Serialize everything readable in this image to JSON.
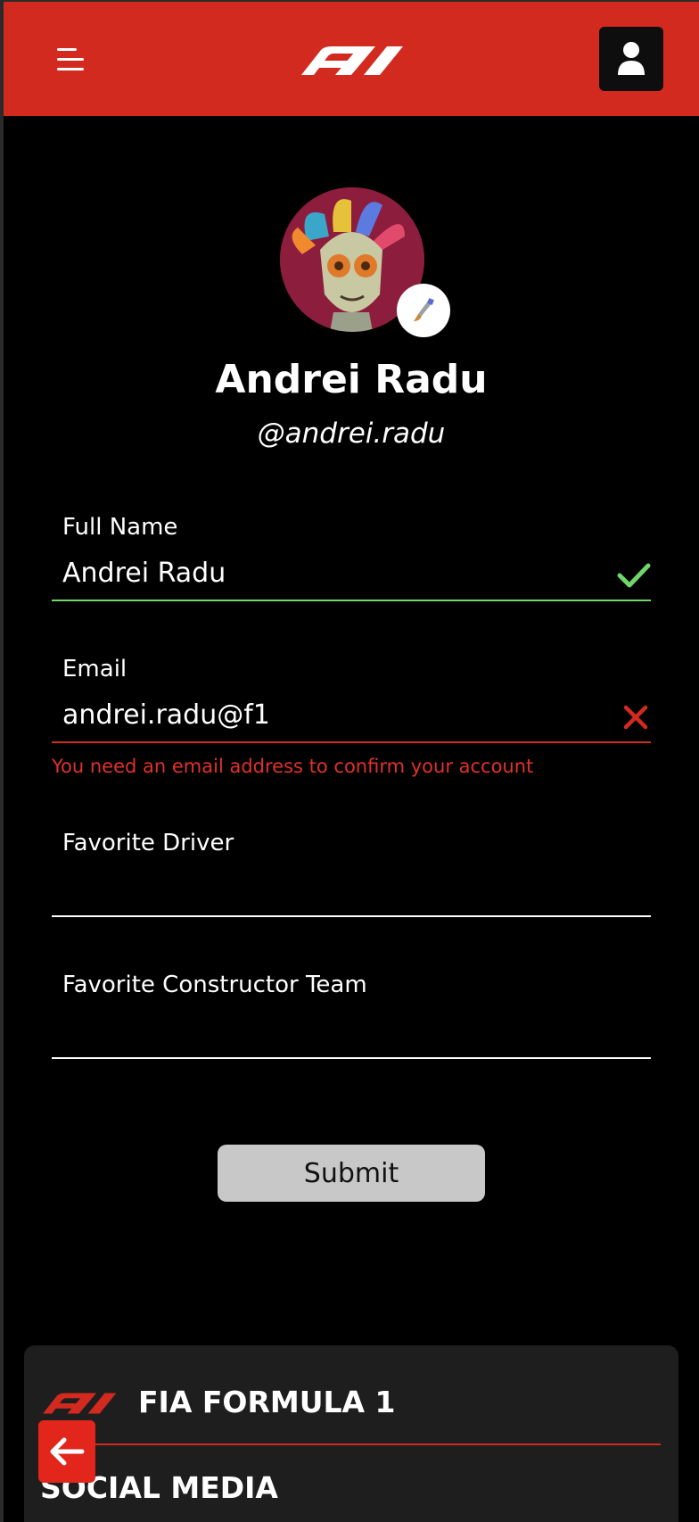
{
  "header": {
    "menu_icon": "hamburger-menu-icon",
    "logo": "f1-logo",
    "user_icon": "user-icon",
    "brand_color": "#d22a1f"
  },
  "profile": {
    "name": "Andrei Radu",
    "handle": "@andrei.radu",
    "avatar_edit_icon": "edit-brush-icon"
  },
  "form": {
    "full_name": {
      "label": "Full Name",
      "value": "Andrei Radu",
      "status": "valid",
      "status_icon": "check-icon",
      "status_color": "#6fd66c"
    },
    "email": {
      "label": "Email",
      "value": "andrei.radu@f1",
      "status": "invalid",
      "status_icon": "close-icon",
      "status_color": "#d22a1f",
      "error": "You need an email address to confirm your account"
    },
    "favorite_driver": {
      "label": "Favorite Driver",
      "value": ""
    },
    "favorite_team": {
      "label": "Favorite Constructor Team",
      "value": ""
    },
    "submit_label": "Submit"
  },
  "footer": {
    "title": "FIA FORMULA 1",
    "social_heading": "SOCIAL MEDIA"
  },
  "back_button": {
    "icon": "arrow-left-icon"
  }
}
